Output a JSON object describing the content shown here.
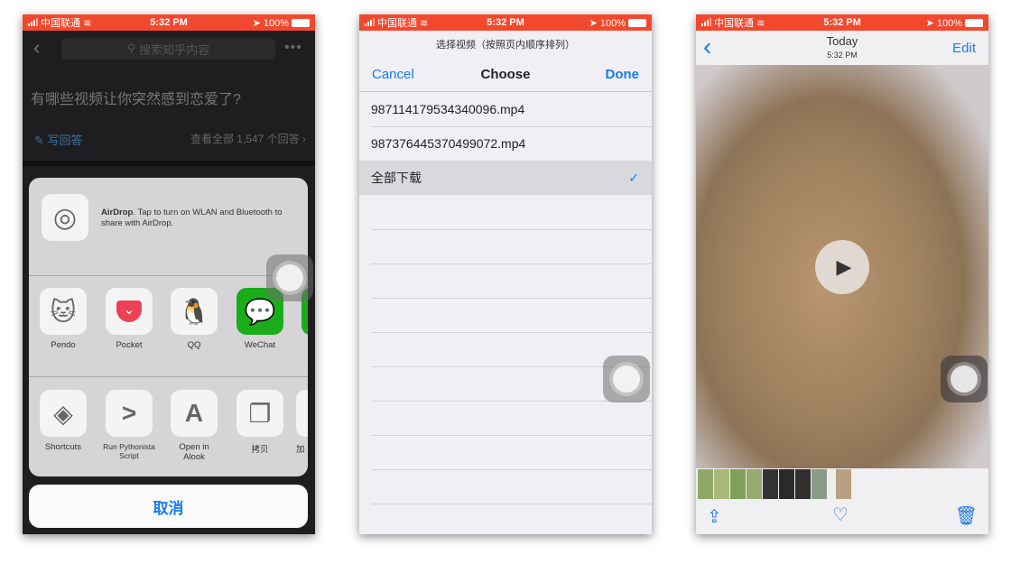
{
  "status": {
    "carrier": "中国联通",
    "time": "5:32 PM",
    "battery": "100%"
  },
  "phone1": {
    "search_placeholder": "搜索知乎内容",
    "question": "有哪些视频让你突然感到恋爱了?",
    "write_answer": "写回答",
    "view_all": "查看全部 1,547 个回答 ›",
    "airdrop_title": "AirDrop",
    "airdrop_text": ". Tap to turn on WLAN and Bluetooth to share with AirDrop.",
    "apps": [
      {
        "label": "Pendo",
        "icon": "cat-icon"
      },
      {
        "label": "Pocket",
        "icon": "pocket-icon"
      },
      {
        "label": "QQ",
        "icon": "penguin-icon"
      },
      {
        "label": "WeChat",
        "icon": "wechat-icon"
      }
    ],
    "actions": [
      {
        "label": "Shortcuts",
        "icon": "layers-icon"
      },
      {
        "label": "Run Pythonista Script",
        "icon": "prompt-icon"
      },
      {
        "label": "Open in Alook",
        "icon": "letter-a-icon"
      },
      {
        "label": "拷贝",
        "icon": "copy-icon"
      },
      {
        "label": "加"
      }
    ],
    "cancel": "取消"
  },
  "phone2": {
    "subtitle": "选择视频（按照页内顺序排列）",
    "cancel": "Cancel",
    "title": "Choose",
    "done": "Done",
    "items": [
      {
        "label": "987114179534340096.mp4",
        "selected": false
      },
      {
        "label": "987376445370499072.mp4",
        "selected": false
      },
      {
        "label": "全部下载",
        "selected": true
      }
    ]
  },
  "phone3": {
    "title": "Today",
    "subtitle": "5:32 PM",
    "edit": "Edit"
  },
  "colors": {
    "accent": "#1a7cf0",
    "status_bar": "#f2492e"
  }
}
